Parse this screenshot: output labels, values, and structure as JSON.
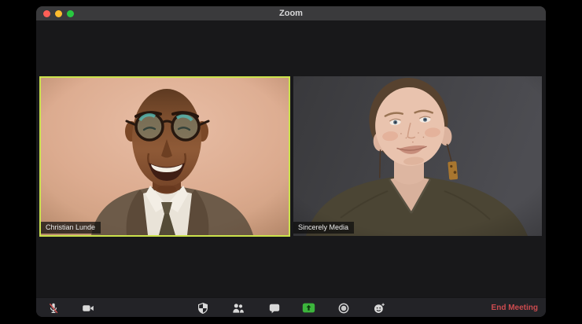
{
  "window": {
    "title": "Zoom"
  },
  "titlebar": {
    "traffic_lights": [
      "close",
      "minimize",
      "fullscreen"
    ]
  },
  "participants": [
    {
      "name": "Christian Lunde",
      "active_speaker": true
    },
    {
      "name": "Sincerely Media",
      "active_speaker": false
    }
  ],
  "toolbar": {
    "buttons": [
      {
        "id": "mute",
        "icon": "microphone-muted-icon",
        "state": "muted"
      },
      {
        "id": "video",
        "icon": "video-camera-icon",
        "state": "on"
      },
      {
        "id": "security",
        "icon": "shield-icon"
      },
      {
        "id": "participants",
        "icon": "participants-icon"
      },
      {
        "id": "chat",
        "icon": "chat-bubble-icon"
      },
      {
        "id": "share-screen",
        "icon": "share-screen-icon"
      },
      {
        "id": "record",
        "icon": "record-icon"
      },
      {
        "id": "reactions",
        "icon": "reactions-smiley-icon"
      }
    ],
    "end_meeting_label": "End Meeting"
  },
  "colors": {
    "active_speaker_border": "#cbe24c",
    "share_screen_green": "#3cb53c",
    "end_meeting_red": "#cc4b4f",
    "mute_slash_red": "#d05050",
    "titlebar_gray": "#3a3a3c",
    "content_background": "#18181a"
  }
}
